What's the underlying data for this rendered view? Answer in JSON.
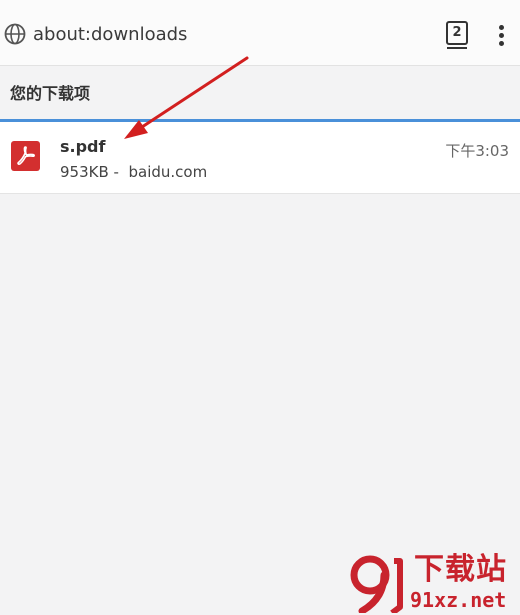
{
  "toolbar": {
    "url": "about:downloads",
    "tab_count": "2",
    "globe_icon": "globe-icon",
    "menu_icon": "more-vert-icon"
  },
  "section": {
    "title": "您的下载项"
  },
  "downloads": [
    {
      "icon": "pdf-file-icon",
      "name": "s.pdf",
      "meta": "953KB -  baidu.com",
      "time": "下午3:03"
    }
  ],
  "watermark": {
    "title": "下载站",
    "domain": "91xz.net"
  },
  "colors": {
    "accent_line": "#4a90d9",
    "pdf_red": "#d32f2f",
    "arrow_red": "#d21f1f",
    "watermark_red": "#c8232d"
  }
}
